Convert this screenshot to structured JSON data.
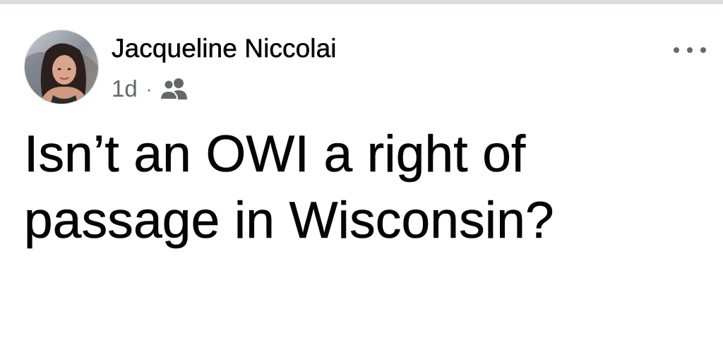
{
  "post": {
    "author": {
      "name": "Jacqueline Niccolai",
      "avatar_icon": "profile-photo"
    },
    "timestamp": "1d",
    "separator": "·",
    "audience_icon": "friends-icon",
    "menu_icon": "more-options-icon",
    "text": "Isn’t an OWI a right of passage in Wisconsin?"
  },
  "colors": {
    "primary_text": "#050505",
    "secondary_text": "#65676b",
    "divider": "#dcdee2",
    "background": "#ffffff"
  }
}
